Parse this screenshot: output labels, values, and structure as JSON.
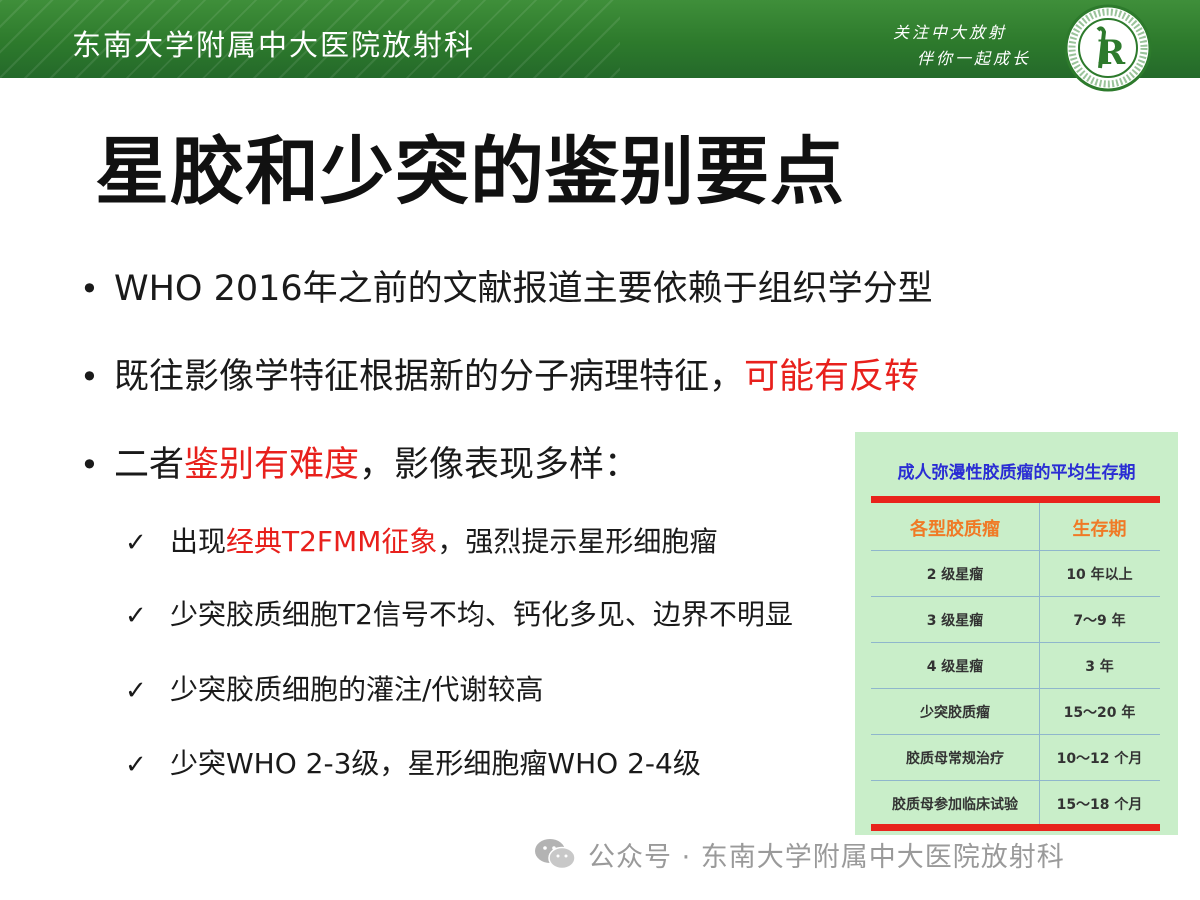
{
  "header": {
    "institution": "东南大学附属中大医院放射科",
    "slogan_line1": "关注中大放射",
    "slogan_line2": "伴你一起成长",
    "logo_letter": "R",
    "green": "#2d7a2c"
  },
  "title": "星胶和少突的鉴别要点",
  "bullets": [
    {
      "bullet": "•",
      "text": "WHO 2016年之前的文献报道主要依赖于组织学分型",
      "highlight": "",
      "tail": ""
    },
    {
      "bullet": "•",
      "text": "既往影像学特征根据新的分子病理特征，",
      "highlight": "可能有反转",
      "tail": ""
    },
    {
      "bullet": "•",
      "text": "二者",
      "highlight": "鉴别有难度",
      "tail": "，影像表现多样："
    }
  ],
  "subpoints": [
    {
      "check": "✓",
      "pre": "出现",
      "highlight": "经典T2FMM征象",
      "post": "，强烈提示星形细胞瘤"
    },
    {
      "check": "✓",
      "pre": "少突胶质细胞T2信号不均、钙化多见、边界不明显",
      "highlight": "",
      "post": ""
    },
    {
      "check": "✓",
      "pre": "少突胶质细胞的灌注/代谢较高",
      "highlight": "",
      "post": ""
    },
    {
      "check": "✓",
      "pre": "少突WHO 2-3级，星形细胞瘤WHO 2-4级",
      "highlight": "",
      "post": ""
    }
  ],
  "table": {
    "title": "成人弥漫性胶质瘤的平均生存期",
    "headers": [
      "各型胶质瘤",
      "生存期"
    ],
    "rows": [
      {
        "type": "2 级星瘤",
        "survival": "10 年以上"
      },
      {
        "type": "3 级星瘤",
        "survival": "7～9 年"
      },
      {
        "type": "4 级星瘤",
        "survival": "3 年"
      },
      {
        "type": "少突胶质瘤",
        "survival": "15～20 年"
      },
      {
        "type": "胶质母常规治疗",
        "survival": "10～12 个月"
      },
      {
        "type": "胶质母参加临床试验",
        "survival": "15～18 个月"
      }
    ],
    "panel_color": "#c9eec9",
    "rule_color": "#e8231c"
  },
  "watermark": "公众号 · 东南大学附属中大医院放射科",
  "colors": {
    "highlight_red": "#e8201c",
    "table_title_blue": "#2a2dd4",
    "header_orange": "#f07a26"
  }
}
